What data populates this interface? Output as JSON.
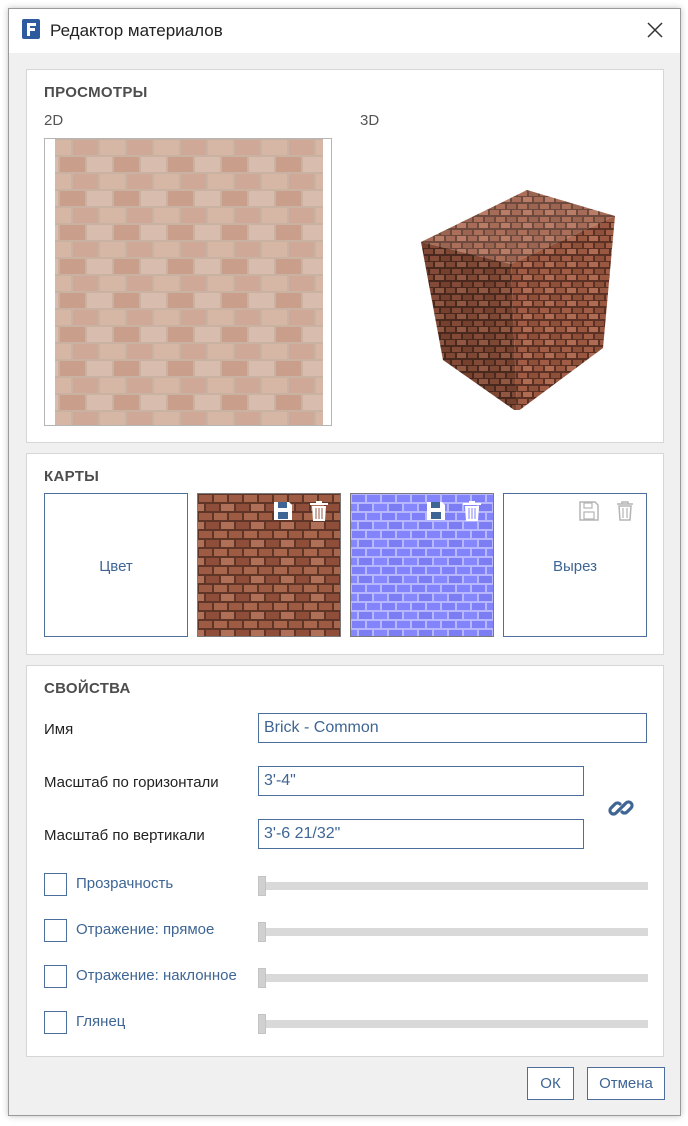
{
  "window": {
    "title": "Редактор материалов"
  },
  "previews": {
    "heading": "ПРОСМОТРЫ",
    "label_2d": "2D",
    "label_3d": "3D"
  },
  "maps": {
    "heading": "КАРТЫ",
    "color_label": "Цвет",
    "cutout_label": "Вырез"
  },
  "properties": {
    "heading": "СВОЙСТВА",
    "name_label": "Имя",
    "name_value": "Brick - Common",
    "hscale_label": "Масштаб по горизонтали",
    "hscale_value": "3'-4\"",
    "vscale_label": "Масштаб по вертикали",
    "vscale_value": "3'-6 21/32\"",
    "sliders": [
      {
        "label": "Прозрачность",
        "checked": false,
        "value": 0
      },
      {
        "label": "Отражение: прямое",
        "checked": false,
        "value": 0
      },
      {
        "label": "Отражение: наклонное",
        "checked": false,
        "value": 0
      },
      {
        "label": "Глянец",
        "checked": false,
        "value": 0
      }
    ]
  },
  "buttons": {
    "ok": "ОК",
    "cancel": "Отмена"
  },
  "colors": {
    "accent": "#3e6594",
    "brick": "#9a5a44",
    "normal_map": "#8080ff"
  }
}
